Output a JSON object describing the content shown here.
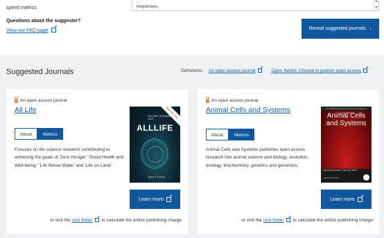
{
  "top": {
    "speed_text": "speed metrics.",
    "textarea_line1": "...",
    "textarea_line2": "responses.",
    "question_title": "Questions about the suggester?",
    "faq_link": "View our FAQ page",
    "reveal_button": "Reveal suggested journals"
  },
  "section": {
    "title": "Suggested Journals",
    "definitions_label": "Definitions:",
    "def_link_1": "An open access journal",
    "def_link_2": "Open Select: Choose to publish open access"
  },
  "journals": [
    {
      "badge": "An open access journal",
      "title": "All Life",
      "tab_about": "About",
      "tab_metrics": "Metrics",
      "description": "Focuses on life science research contributing to achieving the goals of 'Zero Hunger,' 'Good Health and Well-being,' 'Life Below Water' and 'Life on Land.'",
      "cover_title": "ALLLIFE",
      "cover_band": "Open Access",
      "cover_volume": "VOLUME 18 NUMBER 1 2025",
      "cover_publisher": "Taylor & Francis",
      "learn_more": "Learn more",
      "finder_prefix": "or visit the",
      "finder_link": "cost finder",
      "finder_suffix": "to calculate the article publishing charge"
    },
    {
      "badge": "An open access journal",
      "title": "Animal Cells and Systems",
      "tab_about": "About",
      "tab_metrics": "Metrics",
      "description": "Animal Cells and Systems publishes open access research into animal science and biology, evolution, ecology, biochemistry, genetics and genomics.",
      "cover_title": "Animal Cells and Systems",
      "cover_header": "The Official Journal of the Korean Society for Integrative Biology",
      "cover_volume": "Volume 29 Number 1 February 2025",
      "cover_publisher": "Taylor & Francis",
      "learn_more": "Learn more",
      "finder_prefix": "or visit the",
      "finder_link": "cost finder",
      "finder_suffix": "to calculate the article publishing charge"
    }
  ],
  "colors": {
    "primary": "#10579d",
    "link": "#10609f",
    "section_bg": "#eff1f5",
    "lock": "#e8912d"
  }
}
